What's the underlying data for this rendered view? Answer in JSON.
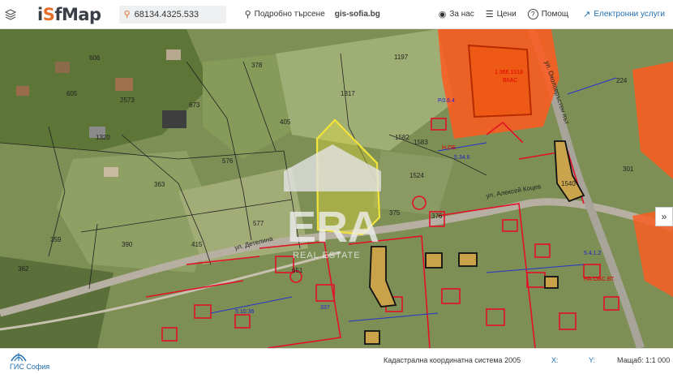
{
  "header": {
    "logo_text_start": "i",
    "logo_text_accent": "S",
    "logo_text_end": "fMap",
    "search_value": "68134.4325.533",
    "advanced_search": "Подробно търсене",
    "gis_link": "gis-sofia.bg",
    "about": "За нас",
    "prices": "Цени",
    "help": "Помощ",
    "services": "Електронни услуги"
  },
  "footer": {
    "gis_logo": "ГИС София",
    "coord_system": "Кадастрална координатна система 2005",
    "x_label": "X:",
    "y_label": "Y:",
    "scale": "Мащаб: 1:1 000"
  },
  "map": {
    "watermark": "ERA",
    "watermark_sub": "REAL ESTATE",
    "parcel_labels": [
      "1197",
      "378",
      "1317",
      "405",
      "576",
      "363",
      "415",
      "390",
      "359",
      "1582",
      "1583",
      "375",
      "377",
      "1540",
      "224",
      "301",
      "2573",
      "605",
      "606",
      "1320",
      "673",
      "1524"
    ],
    "street_labels": [
      "ул. Алексей Коцев",
      "ул. Детелина"
    ],
    "colors": {
      "highlight": "#f2e43a",
      "restricted": "#ff5a1f",
      "cadastre_red": "#e3102a",
      "cadastre_blue": "#2233cc",
      "boundary": "#222222"
    }
  }
}
